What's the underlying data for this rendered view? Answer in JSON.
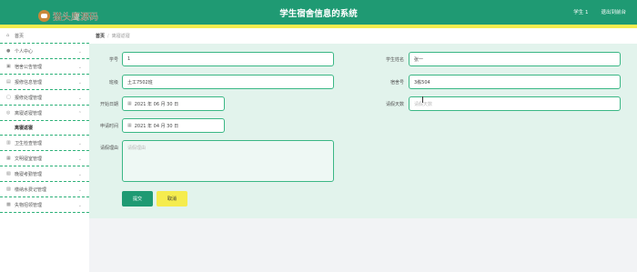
{
  "header": {
    "logo_text": "猫头鹰源码",
    "title": "学生宿舍信息的系统",
    "user_label": "学生 1",
    "logout_label": "退出到前台",
    "accent": "#1f9a73",
    "stripe": "#f5ec4e"
  },
  "sidebar": {
    "items": [
      {
        "label": "首页",
        "icon": "home-icon"
      },
      {
        "label": "个人中心",
        "icon": "user-icon"
      },
      {
        "label": "宿舍公告管理",
        "icon": "notice-icon"
      },
      {
        "label": "报修信息管理",
        "icon": "wrench-icon"
      },
      {
        "label": "报修处理管理",
        "icon": "check-icon"
      },
      {
        "label": "离寝返寝管理",
        "icon": "door-icon"
      },
      {
        "label": "离寝返寝",
        "icon": ""
      },
      {
        "label": "卫生检查管理",
        "icon": "broom-icon"
      },
      {
        "label": "文明寝室管理",
        "icon": "star-icon"
      },
      {
        "label": "晚寝考勤管理",
        "icon": "clock-icon"
      },
      {
        "label": "缴纳水费记管理",
        "icon": "water-icon"
      },
      {
        "label": "失物招领管理",
        "icon": "box-icon"
      }
    ]
  },
  "breadcrumb": {
    "home": "首页",
    "sep": "/",
    "current": "离寝返寝"
  },
  "form": {
    "student_no_label": "学号",
    "student_no_value": "1",
    "student_name_label": "学生姓名",
    "student_name_value": "张一",
    "class_label": "班级",
    "class_value": "土工7502班",
    "dorm_no_label": "宿舍号",
    "dorm_no_value": "3栋504",
    "start_date_label": "开始日期",
    "start_date_value": "2021 年 06 月 30 日",
    "leave_days_label": "请假天数",
    "leave_days_placeholder": "请假天数",
    "apply_time_label": "申请时间",
    "apply_time_value": "2021 年 04 月 30 日",
    "reason_label": "请假理由",
    "reason_placeholder": "请假理由",
    "submit_label": "提交",
    "cancel_label": "取消"
  }
}
